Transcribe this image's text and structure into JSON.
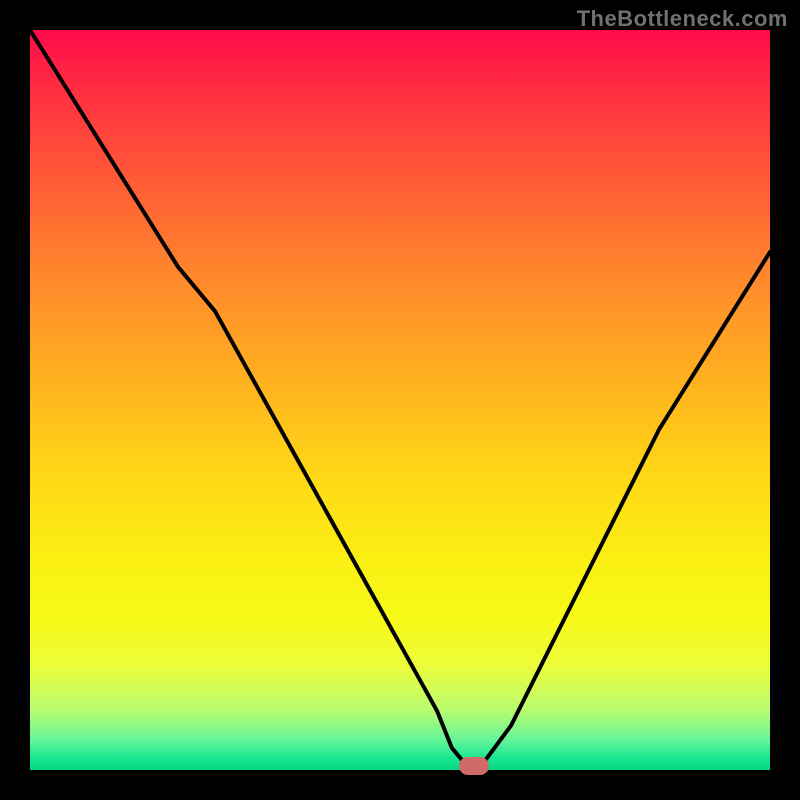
{
  "watermark": "TheBottleneck.com",
  "colors": {
    "background": "#000000",
    "curve": "#000000",
    "marker": "#cf6a66",
    "watermark": "#71706f"
  },
  "chart_data": {
    "type": "line",
    "title": "",
    "xlabel": "",
    "ylabel": "",
    "xlim": [
      0,
      100
    ],
    "ylim": [
      0,
      100
    ],
    "grid": false,
    "description": "Bottleneck percentage curve on a red-to-green gradient heatmap. The black curve represents bottleneck %, lowest near x≈60 where the green band indicates optimal balance.",
    "annotations": [
      {
        "type": "marker",
        "x": 60,
        "y": 0.6,
        "color": "#cf6a66",
        "shape": "pill"
      }
    ],
    "series": [
      {
        "name": "bottleneck-curve",
        "color": "#000000",
        "x": [
          0,
          5,
          10,
          15,
          20,
          25,
          30,
          35,
          40,
          45,
          50,
          55,
          57,
          59,
          61,
          65,
          70,
          75,
          80,
          85,
          90,
          95,
          100
        ],
        "y": [
          100,
          92,
          84,
          76,
          68,
          62,
          53,
          44,
          35,
          26,
          17,
          8,
          3,
          0.6,
          0.6,
          6,
          16,
          26,
          36,
          46,
          54,
          62,
          70
        ]
      }
    ],
    "gradient_stops": [
      {
        "pos": 0.0,
        "color": "#ff0a49"
      },
      {
        "pos": 0.08,
        "color": "#ff2d42"
      },
      {
        "pos": 0.2,
        "color": "#ff5a36"
      },
      {
        "pos": 0.34,
        "color": "#ff8a2b"
      },
      {
        "pos": 0.48,
        "color": "#ffb31f"
      },
      {
        "pos": 0.6,
        "color": "#ffd716"
      },
      {
        "pos": 0.72,
        "color": "#faf013"
      },
      {
        "pos": 0.8,
        "color": "#f7fa19"
      },
      {
        "pos": 0.86,
        "color": "#ecfc3b"
      },
      {
        "pos": 0.92,
        "color": "#b7fc70"
      },
      {
        "pos": 0.96,
        "color": "#63f59a"
      },
      {
        "pos": 0.985,
        "color": "#17e58f"
      },
      {
        "pos": 1.0,
        "color": "#00d884"
      }
    ]
  }
}
